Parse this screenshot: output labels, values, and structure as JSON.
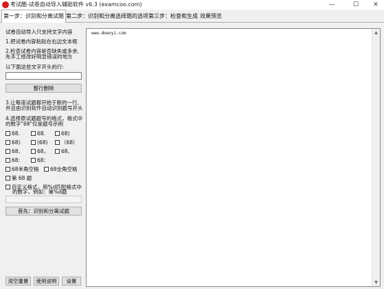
{
  "window": {
    "title": "考试酷-试卷自动导入辅助软件 v6.3 (examcoo.com)",
    "minimize": "—",
    "maximize": "☐",
    "close": "✕"
  },
  "tabs": [
    {
      "label": "第一步：识别和分离试题",
      "active": true
    },
    {
      "label": "第二步：识别和分离选择题的选项",
      "active": false
    },
    {
      "label": "第三步：检查和生成",
      "active": false
    },
    {
      "label": "效果预览",
      "active": false
    }
  ],
  "panel": {
    "note": "试卷自动导入只支持文字内容",
    "step1": "1.把试卷内容粘贴在右边文本框",
    "step2_line1": "2.检查试卷内容是否缺失或多余,",
    "step2_line2": "先手工修改好明显错误的地方",
    "delete_label": "以下面这些文字开头的行:",
    "delete_value": "",
    "delete_button": "整行删除",
    "step3_line1": "3.让每道试题都开始于新的一行,",
    "step3_line2": "并且由识别软件自动识别题号开头",
    "step4_line1": "4.选择原试题题号的格式，格式中",
    "step4_line2": "的数字\"68\"仅是题号示例",
    "formats_row1": [
      "68.",
      "68.",
      "68)"
    ],
    "formats_row2": [
      "68)",
      "(68)",
      "（68）"
    ],
    "formats_row3": [
      "68、",
      "68，",
      "68、"
    ],
    "formats_row4": [
      "68:",
      "68："
    ],
    "half_space": "68半角空格",
    "full_space": "68全角空格",
    "di_ti": "第 68 题",
    "custom_line1": "自定义格式，用%d匹配格式中",
    "custom_line2": "的数字，例如：第%d题",
    "custom_value": "",
    "identify_button": "首先：识别和分离试题",
    "clear_button": "清空重置",
    "help_button": "使用说明",
    "settings_button": "设置"
  },
  "editor": {
    "content": "www.downyi.com"
  },
  "colors": {
    "app_icon": "#d42020",
    "background": "#f0f0f0",
    "editor_bg": "#ffffff"
  }
}
